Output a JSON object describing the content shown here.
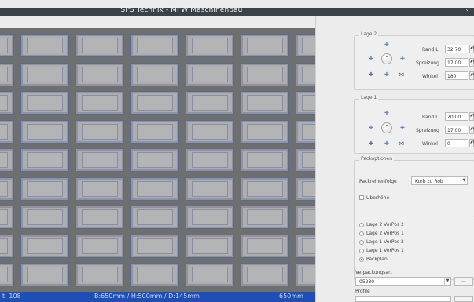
{
  "window": {
    "title": "SPS Technik - MFW Maschinenbau"
  },
  "status": {
    "left": "t: 108",
    "center": "B:650mm / H:500mm / D:145mm",
    "right": "650mm"
  },
  "lage2": {
    "legend": "Lage 2",
    "rand_label": "Rand L",
    "rand_value": "32,70",
    "spreizung_label": "Spreizung",
    "spreizung_value": "17,00",
    "winkel_label": "Winkel",
    "winkel_value": "180"
  },
  "lage1": {
    "legend": "Lage 1",
    "rand_label": "Rand L",
    "rand_value": "20,00",
    "spreizung_label": "Spreizung",
    "spreizung_value": "17,00",
    "winkel_label": "Winkel",
    "winkel_value": "0"
  },
  "packoptionen": {
    "legend": "Packoptionen",
    "reihenfolge_label": "Packreihenfolge",
    "reihenfolge_value": "Korb zu Rob",
    "ueberhoehe_label": "Überhöhe",
    "ueberhoehe_checked": false
  },
  "views": {
    "options": [
      "Lage 2 VorPos 2",
      "Lage 2 VorPos 1",
      "Lage 1 VorPos 2",
      "Lage 1 VorPos 1",
      "Packplan"
    ],
    "selected": "Packplan"
  },
  "verpackungsart": {
    "label": "Verpackungsart",
    "value": "05230",
    "button": "..."
  },
  "profile": {
    "label": "Profile"
  },
  "colors": {
    "titlebar": "#3b4349",
    "status": "#1f4fb5",
    "viewport": "#6e706f",
    "tile": "#adaeb1"
  }
}
